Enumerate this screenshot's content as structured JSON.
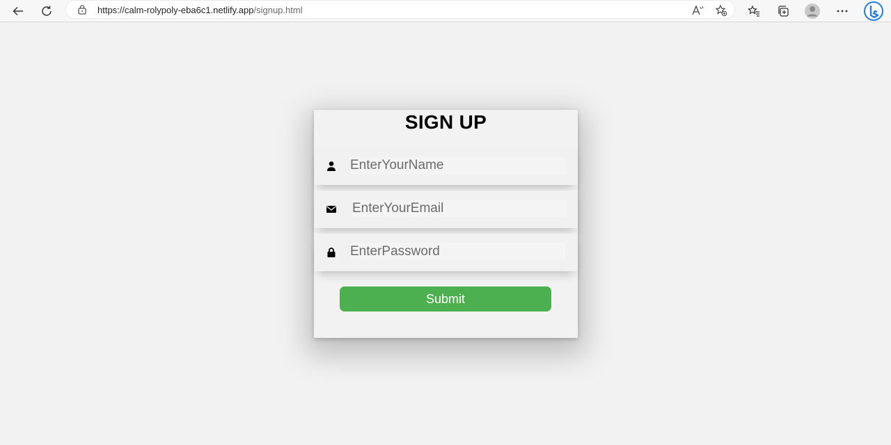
{
  "browser": {
    "url_host": "https://calm-rolypoly-eba6c1.netlify.app",
    "url_path": "/signup.html"
  },
  "form": {
    "title": "SIGN UP",
    "name_placeholder": "EnterYourName",
    "email_placeholder": "EnterYourEmail",
    "password_placeholder": "EnterPassword",
    "submit_label": "Submit",
    "submit_color": "#4caf50"
  },
  "icons": [
    "back-icon",
    "refresh-icon",
    "lock-icon",
    "read-aloud-icon",
    "add-favorite-icon",
    "favorites-icon",
    "collections-icon",
    "profile-icon",
    "more-icon",
    "bing-icon",
    "user-icon",
    "envelope-icon",
    "padlock-icon"
  ]
}
